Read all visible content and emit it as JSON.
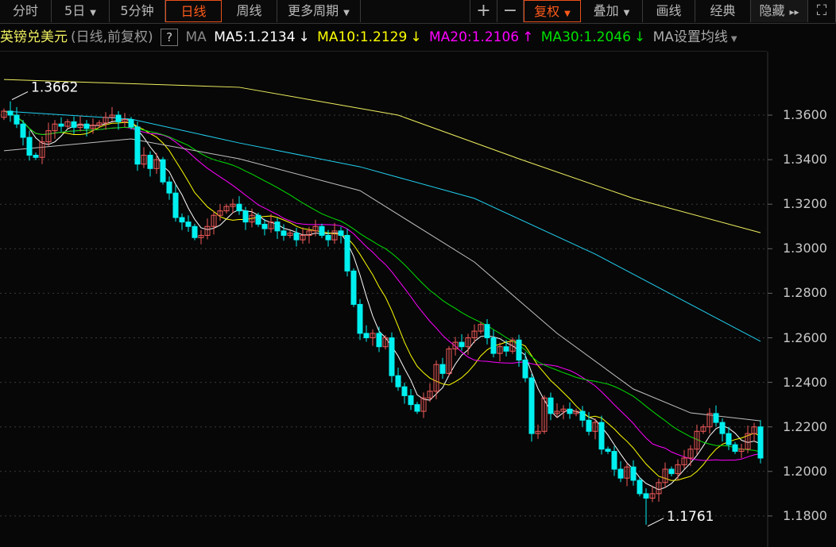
{
  "toolbar": {
    "tabs": [
      {
        "label": "分时"
      },
      {
        "label": "5日",
        "caret": "▼"
      },
      {
        "label": "5分钟"
      },
      {
        "label": "日线"
      },
      {
        "label": "周线"
      },
      {
        "label": "更多周期",
        "caret": "▼"
      }
    ],
    "active_tab": "日线",
    "zoom_in": "+",
    "zoom_out": "−",
    "right": [
      {
        "label": "复权",
        "caret": "▼"
      },
      {
        "label": "叠加",
        "caret": "▼"
      },
      {
        "label": "画线"
      },
      {
        "label": "经典"
      },
      {
        "label": "隐藏",
        "caret": "▸▸"
      }
    ],
    "fullscreen_icon": "⛶"
  },
  "legend": {
    "symbol": "英镑兑美元",
    "mode": "(日线,前复权)",
    "help": "?",
    "ma_label": "MA",
    "ma5": "MA5:1.2134",
    "ma5_arrow": "↓",
    "ma10": "MA10:1.2129",
    "ma10_arrow": "↓",
    "ma20": "MA20:1.2106",
    "ma20_arrow": "↑",
    "ma30": "MA30:1.2046",
    "ma30_arrow": "↓",
    "settings": "MA设置均线",
    "settings_caret": "▼"
  },
  "colors": {
    "up": "#f25a5a",
    "down": "#00f0f0",
    "ma5": "#ffffff",
    "ma10": "#ffff00",
    "ma20": "#ff00ff",
    "ma30": "#00e000",
    "ma60": "#c0c0c0",
    "ma120": "#20d0f0",
    "ma250": "#f0f060",
    "accent": "#ff5a1a"
  },
  "chart_data": {
    "type": "candlestick",
    "title": "英镑兑美元 日线",
    "y_ticks": [
      "1.3600",
      "1.3400",
      "1.3200",
      "1.3000",
      "1.2800",
      "1.2600",
      "1.2400",
      "1.2200",
      "1.2000",
      "1.1800"
    ],
    "ylim": [
      1.172,
      1.388
    ],
    "annotations": {
      "high": "1.3662",
      "low": "1.1761"
    },
    "close": [
      1.3618,
      1.36,
      1.356,
      1.35,
      1.342,
      1.341,
      1.348,
      1.353,
      1.356,
      1.355,
      1.357,
      1.3545,
      1.356,
      1.354,
      1.3555,
      1.3565,
      1.359,
      1.36,
      1.357,
      1.358,
      1.3547,
      1.338,
      1.342,
      1.336,
      1.34,
      1.33,
      1.325,
      1.314,
      1.312,
      1.31,
      1.305,
      1.306,
      1.31,
      1.315,
      1.317,
      1.319,
      1.32,
      1.317,
      1.312,
      1.315,
      1.311,
      1.309,
      1.312,
      1.308,
      1.306,
      1.307,
      1.304,
      1.306,
      1.308,
      1.31,
      1.306,
      1.304,
      1.308,
      1.306,
      1.29,
      1.275,
      1.262,
      1.26,
      1.262,
      1.256,
      1.26,
      1.243,
      1.238,
      1.234,
      1.23,
      1.227,
      1.233,
      1.236,
      1.248,
      1.244,
      1.255,
      1.258,
      1.256,
      1.26,
      1.263,
      1.266,
      1.26,
      1.253,
      1.256,
      1.254,
      1.259,
      1.25,
      1.242,
      1.217,
      1.218,
      1.233,
      1.226,
      1.227,
      1.228,
      1.226,
      1.227,
      1.223,
      1.218,
      1.222,
      1.21,
      1.209,
      1.201,
      1.197,
      1.202,
      1.196,
      1.19,
      1.188,
      1.19,
      1.195,
      1.201,
      1.199,
      1.203,
      1.206,
      1.21,
      1.218,
      1.22,
      1.226,
      1.222,
      1.217,
      1.212,
      1.209,
      1.21,
      1.217,
      1.22,
      1.206
    ],
    "first_open": 1.359,
    "high_index": 1,
    "high_value": 1.3662,
    "low_index": 101,
    "low_value": 1.1761,
    "long_ma": [
      {
        "name": "MA60",
        "points": [
          [
            0,
            1.344
          ],
          [
            20,
            1.3493
          ],
          [
            37,
            1.3404
          ],
          [
            56,
            1.3261
          ],
          [
            74,
            1.294
          ],
          [
            87,
            1.262
          ],
          [
            99,
            1.237
          ],
          [
            108,
            1.2263
          ],
          [
            119,
            1.2227
          ]
        ]
      },
      {
        "name": "MA120",
        "points": [
          [
            0,
            1.3618
          ],
          [
            20,
            1.3582
          ],
          [
            37,
            1.3475
          ],
          [
            56,
            1.3368
          ],
          [
            74,
            1.3226
          ],
          [
            93,
            1.2976
          ],
          [
            119,
            1.2584
          ]
        ]
      },
      {
        "name": "MA250",
        "points": [
          [
            0,
            1.376
          ],
          [
            37,
            1.3725
          ],
          [
            62,
            1.36
          ],
          [
            81,
            1.3404
          ],
          [
            99,
            1.3226
          ],
          [
            119,
            1.3072
          ]
        ]
      }
    ]
  }
}
